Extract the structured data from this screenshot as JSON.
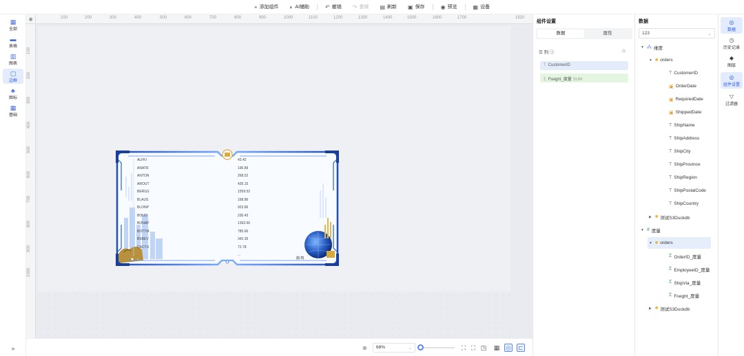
{
  "toolbar": {
    "items": [
      {
        "icon": "plus-icon",
        "glyph": "+",
        "label": "添加组件"
      },
      {
        "icon": "ai-assist-icon",
        "glyph": "◐",
        "label": "AI辅助"
      },
      {
        "icon": "undo-icon",
        "glyph": "↶",
        "label": "撤销"
      },
      {
        "icon": "redo-icon",
        "glyph": "↷",
        "label": "重做"
      },
      {
        "icon": "refresh-icon",
        "glyph": "▤",
        "label": "刷新"
      },
      {
        "icon": "save-icon",
        "glyph": "▣",
        "label": "保存"
      },
      {
        "icon": "preview-icon",
        "glyph": "◉",
        "label": "预览"
      },
      {
        "icon": "settings-icon",
        "glyph": "▦",
        "label": "设备"
      }
    ]
  },
  "leftbar": {
    "items": [
      {
        "icon": "grid-icon",
        "glyph": "▦",
        "label": "全部"
      },
      {
        "icon": "table-icon",
        "glyph": "▬",
        "label": "表格"
      },
      {
        "icon": "chart-icon",
        "glyph": "▥",
        "label": "图表"
      },
      {
        "icon": "border-icon",
        "glyph": "▢",
        "label": "边框"
      },
      {
        "icon": "shapes-icon",
        "glyph": "♣",
        "label": "图标"
      },
      {
        "icon": "basic-icon",
        "glyph": "▦",
        "label": "基础"
      }
    ],
    "expand": "»"
  },
  "ruler": {
    "top": [
      "100",
      "200",
      "300",
      "400",
      "500",
      "600",
      "700",
      "800",
      "900",
      "1000",
      "1100",
      "1200",
      "1300",
      "1400",
      "1500",
      "1600",
      "1700",
      "1920"
    ],
    "left": [
      "100",
      "200",
      "300",
      "400",
      "500",
      "600",
      "700",
      "800",
      "900",
      "1000"
    ]
  },
  "table": {
    "rows": [
      [
        "ALFKI",
        "43.42"
      ],
      [
        "ANATR",
        "190.89"
      ],
      [
        "ANTON",
        "268.52"
      ],
      [
        "AROUT",
        "435.15"
      ],
      [
        "BERGS",
        "1559.52"
      ],
      [
        "BLAUS",
        "168.86"
      ],
      [
        "BLONP",
        "923.86"
      ],
      [
        "BOLID",
        "230.43"
      ],
      [
        "BONAP",
        "1392.00"
      ],
      [
        "BOTTM",
        "785.66"
      ],
      [
        "BSBEV",
        "342.35"
      ],
      [
        "CACTU",
        "72.78"
      ],
      [
        "",
        "..."
      ]
    ],
    "frame_label": "鼎 鸣"
  },
  "bottombar": {
    "zoom": "68%",
    "zoom_level": 0.0
  },
  "settings_panel": {
    "title": "组件设置",
    "tabs": [
      "数据",
      "属性"
    ],
    "column_label": "列",
    "fields": [
      {
        "type": "T",
        "name": "CustomerID",
        "sub": ""
      },
      {
        "type": "Σ",
        "name": "Freight_度量",
        "sub": "SUM"
      }
    ]
  },
  "data_panel": {
    "title": "数据",
    "search": "123",
    "tree": [
      {
        "level": 0,
        "caret": "▼",
        "icon": "dimension-icon",
        "kind": "dim",
        "glyph": "⁂",
        "label": "维度"
      },
      {
        "level": 1,
        "caret": "▼",
        "icon": "folder-icon",
        "kind": "folder",
        "glyph": "■",
        "label": "orders"
      },
      {
        "level": 2,
        "caret": "",
        "icon": "text-field-icon",
        "kind": "t",
        "glyph": "T",
        "label": "CustomerID"
      },
      {
        "level": 2,
        "caret": "",
        "icon": "date-field-icon",
        "kind": "date",
        "glyph": "▣",
        "label": "OrderDate"
      },
      {
        "level": 2,
        "caret": "",
        "icon": "date-field-icon",
        "kind": "date",
        "glyph": "▣",
        "label": "RequiredDate"
      },
      {
        "level": 2,
        "caret": "",
        "icon": "date-field-icon",
        "kind": "date",
        "glyph": "▣",
        "label": "ShippedDate"
      },
      {
        "level": 2,
        "caret": "",
        "icon": "text-field-icon",
        "kind": "t",
        "glyph": "T",
        "label": "ShipName"
      },
      {
        "level": 2,
        "caret": "",
        "icon": "text-field-icon",
        "kind": "t",
        "glyph": "T",
        "label": "ShipAddress"
      },
      {
        "level": 2,
        "caret": "",
        "icon": "text-field-icon",
        "kind": "t",
        "glyph": "T",
        "label": "ShipCity"
      },
      {
        "level": 2,
        "caret": "",
        "icon": "text-field-icon",
        "kind": "t",
        "glyph": "T",
        "label": "ShipProvince"
      },
      {
        "level": 2,
        "caret": "",
        "icon": "text-field-icon",
        "kind": "t",
        "glyph": "T",
        "label": "ShipRegion"
      },
      {
        "level": 2,
        "caret": "",
        "icon": "text-field-icon",
        "kind": "t",
        "glyph": "T",
        "label": "ShipPostalCode"
      },
      {
        "level": 2,
        "caret": "",
        "icon": "text-field-icon",
        "kind": "t",
        "glyph": "T",
        "label": "ShipCountry"
      },
      {
        "level": 1,
        "caret": "▶",
        "icon": "folder-icon",
        "kind": "folder",
        "glyph": "■",
        "label": "测试S3Duckdb"
      },
      {
        "level": 0,
        "caret": "▼",
        "icon": "measure-icon",
        "kind": "mea",
        "glyph": "#",
        "label": "度量"
      },
      {
        "level": 1,
        "caret": "▼",
        "icon": "folder-icon",
        "kind": "folder",
        "glyph": "■",
        "label": "orders",
        "selected": true
      },
      {
        "level": 2,
        "caret": "",
        "icon": "sum-field-icon",
        "kind": "sum",
        "glyph": "Σ",
        "label": "OrderID_度量"
      },
      {
        "level": 2,
        "caret": "",
        "icon": "sum-field-icon",
        "kind": "sum",
        "glyph": "Σ",
        "label": "EmployeeID_度量"
      },
      {
        "level": 2,
        "caret": "",
        "icon": "sum-field-icon",
        "kind": "sum",
        "glyph": "Σ",
        "label": "ShipVia_度量"
      },
      {
        "level": 2,
        "caret": "",
        "icon": "sum-field-icon",
        "kind": "sum",
        "glyph": "Σ",
        "label": "Freight_度量"
      },
      {
        "level": 1,
        "caret": "▶",
        "icon": "folder-icon",
        "kind": "folder",
        "glyph": "■",
        "label": "测试S3Duckdb"
      }
    ]
  },
  "rightbar": {
    "items": [
      {
        "icon": "database-icon",
        "glyph": "◎",
        "label": "数据"
      },
      {
        "icon": "history-icon",
        "glyph": "◷",
        "label": "历史记录"
      },
      {
        "icon": "layers-icon",
        "glyph": "◆",
        "label": "图层"
      },
      {
        "icon": "component-settings-icon",
        "glyph": "◎",
        "label": "组件设置"
      },
      {
        "icon": "filter-icon",
        "glyph": "▽",
        "label": "过滤器"
      }
    ]
  }
}
